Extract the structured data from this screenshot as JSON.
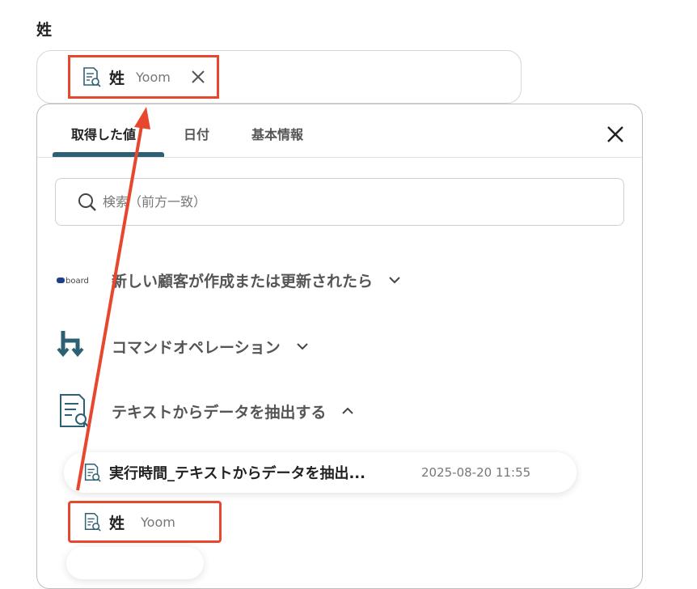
{
  "field": {
    "label": "姓",
    "chip": {
      "name": "姓",
      "source": "Yoom"
    }
  },
  "panel": {
    "tabs": [
      {
        "label": "取得した値",
        "active": true
      },
      {
        "label": "日付",
        "active": false
      },
      {
        "label": "基本情報",
        "active": false
      }
    ],
    "search": {
      "placeholder": "検索（前方一致）",
      "value": ""
    },
    "sections": [
      {
        "label": "新しい顧客が作成または更新されたら",
        "icon": "board-logo-icon",
        "expanded": false
      },
      {
        "label": "コマンドオペレーション",
        "icon": "yoom-command-icon",
        "expanded": false
      },
      {
        "label": "テキストからデータを抽出する",
        "icon": "document-search-icon",
        "expanded": true
      }
    ],
    "result_row": {
      "title": "実行時間_テキストからデータを抽出...",
      "time": "2025-08-20 11:55"
    },
    "value_item": {
      "name": "姓",
      "source": "Yoom"
    }
  },
  "colors": {
    "accent": "#2e6073",
    "highlight": "#e8472f"
  }
}
